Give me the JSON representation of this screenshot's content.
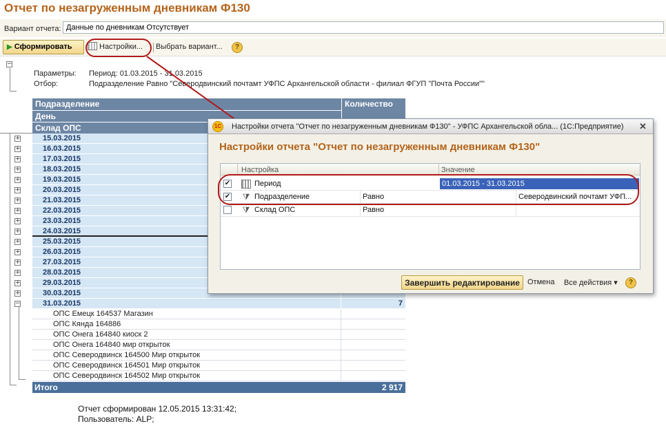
{
  "report": {
    "title": "Отчет по незагруженным дневникам Ф130",
    "variant_label": "Вариант отчета:",
    "variant_value": "Данные по дневникам Отсутствует"
  },
  "toolbar": {
    "generate_label": "Сформировать",
    "settings_label": "Настройки...",
    "choose_variant_label": "Выбрать вариант...",
    "help_label": "?"
  },
  "params": {
    "params_label": "Параметры:",
    "params_value": "Период: 01.03.2015 - 31.03.2015",
    "filter_label": "Отбор:",
    "filter_value": "Подразделение Равно \"Северодвинский почтамт УФПС Архангельской области - филиал ФГУП \"Почта России\"\""
  },
  "table": {
    "headers": {
      "division": "Подразделение",
      "day": "День",
      "warehouse": "Склад ОПС",
      "quantity": "Количество"
    },
    "dates": [
      {
        "date": "15.03.2015",
        "value": ""
      },
      {
        "date": "16.03.2015",
        "value": ""
      },
      {
        "date": "17.03.2015",
        "value": ""
      },
      {
        "date": "18.03.2015",
        "value": ""
      },
      {
        "date": "19.03.2015",
        "value": ""
      },
      {
        "date": "20.03.2015",
        "value": ""
      },
      {
        "date": "21.03.2015",
        "value": ""
      },
      {
        "date": "22.03.2015",
        "value": ""
      },
      {
        "date": "23.03.2015",
        "value": ""
      },
      {
        "date": "24.03.2015",
        "value": ""
      },
      {
        "date": "25.03.2015",
        "value": ""
      },
      {
        "date": "26.03.2015",
        "value": ""
      },
      {
        "date": "27.03.2015",
        "value": ""
      },
      {
        "date": "28.03.2015",
        "value": ""
      },
      {
        "date": "29.03.2015",
        "value": ""
      },
      {
        "date": "30.03.2015",
        "value": ""
      },
      {
        "date": "31.03.2015",
        "value": "7"
      }
    ],
    "sub_items": [
      "ОПС Емецк 164537 Магазин",
      "ОПС Кянда 164886",
      "ОПС Онега 164840 киоск 2",
      "ОПС Онега 164840 мир открыток",
      "ОПС Северодвинск 164500 Мир открыток",
      "ОПС Северодвинск 164501 Мир открыток",
      "ОПС Северодвинск 164502 Мир открыток"
    ],
    "total_label": "Итого",
    "total_value": "2 917"
  },
  "footer": {
    "generated": "Отчет сформирован 12.05.2015 13:31:42;",
    "user": "Пользователь: ALP;"
  },
  "dialog": {
    "logo": "1С",
    "title": "Настройки отчета \"Отчет по незагруженным дневникам Ф130\" - УФПС Архангельской обла... (1С:Предприятие)",
    "close": "✕",
    "heading": "Настройки отчета \"Отчет по незагруженным дневникам Ф130\"",
    "col_setting": "Настройка",
    "col_value": "Значение",
    "rows": [
      {
        "checked": "✔",
        "name": "Период",
        "compare": "",
        "value": "01.03.2015 - 31.03.2015"
      },
      {
        "checked": "✔",
        "name": "Подразделение",
        "compare": "Равно",
        "value": "Северодвинский почтамт УФП..."
      },
      {
        "checked": "",
        "name": "Склад ОПС",
        "compare": "Равно",
        "value": ""
      }
    ],
    "finish_label": "Завершить редактирование",
    "cancel_label": "Отмена",
    "actions_label": "Все действия ▾",
    "help_label": "?"
  },
  "colors": {
    "title": "#b4631a",
    "header_bg": "#6d86a4",
    "date_row_bg": "#d5e6f5",
    "total_bg": "#4a6f9b",
    "selection": "#3a62b8",
    "annotation": "#b01818"
  }
}
